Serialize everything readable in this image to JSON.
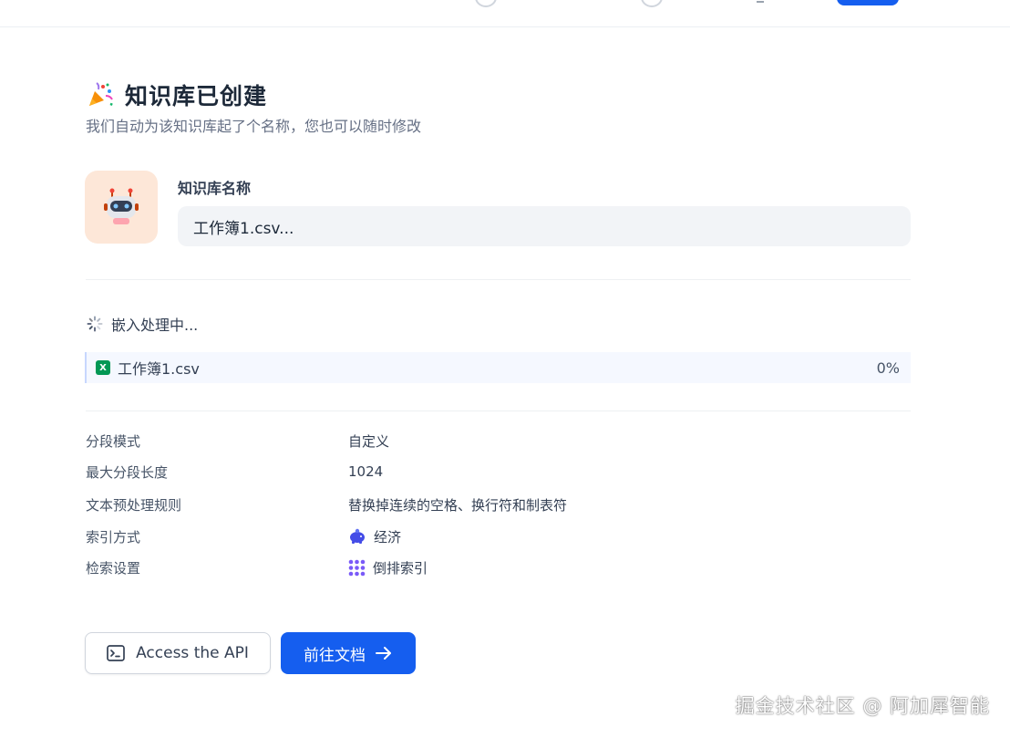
{
  "header": {
    "title": "知识库已创建",
    "subtitle": "我们自动为该知识库起了个名称，您也可以随时修改"
  },
  "name_field": {
    "label": "知识库名称",
    "value": "工作簿1.csv..."
  },
  "embedding": {
    "status": "嵌入处理中...",
    "file": {
      "name": "工作簿1.csv",
      "progress": "0%",
      "type_badge": "X"
    }
  },
  "settings": [
    {
      "key": "分段模式",
      "value": "自定义",
      "icon": ""
    },
    {
      "key": "最大分段长度",
      "value": "1024",
      "icon": ""
    },
    {
      "key": "文本预处理规则",
      "value": "替换掉连续的空格、换行符和制表符",
      "icon": ""
    },
    {
      "key": "索引方式",
      "value": "经济",
      "icon": "piggy-bank-icon"
    },
    {
      "key": "检索设置",
      "value": "倒排索引",
      "icon": "grid-dots-icon"
    }
  ],
  "actions": {
    "api_label": "Access the API",
    "docs_label": "前往文档"
  },
  "watermark": "掘金技术社区 @ 阿加犀智能",
  "colors": {
    "primary": "#155eef",
    "file_row_bg": "#f5f8ff",
    "excel_green": "#039855",
    "avatar_bg": "#fde7d8"
  }
}
